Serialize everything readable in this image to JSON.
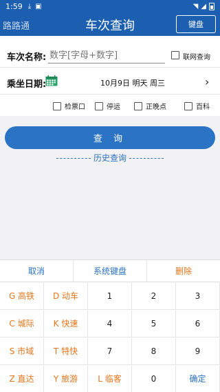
{
  "status": {
    "time": "1:59"
  },
  "appbar": {
    "brand": "路路通",
    "title": "车次查询",
    "keyboard_button": "键盘"
  },
  "form": {
    "train_label": "车次名称:",
    "train_placeholder": "数字[字母+数字]",
    "online_label": "联网查询",
    "date_label": "乘坐日期:",
    "date_value": "10月9日 明天 周三",
    "options": [
      {
        "label": "检票口",
        "checked": false
      },
      {
        "label": "停运",
        "checked": false
      },
      {
        "label": "正晚点",
        "checked": false
      },
      {
        "label": "百科",
        "checked": false
      }
    ]
  },
  "query_button": "查 询",
  "history_link": "历史查询",
  "keyboard": {
    "top": {
      "cancel": "取消",
      "system": "系统键盘",
      "delete": "删除"
    },
    "colors": {
      "letter": "#e8741a",
      "action": "#2b73c4"
    },
    "keys": [
      [
        "G 高铁",
        "D 动车",
        "1",
        "2",
        "3"
      ],
      [
        "C 城际",
        "K 快速",
        "4",
        "5",
        "6"
      ],
      [
        "S 市域",
        "T 特快",
        "7",
        "8",
        "9"
      ],
      [
        "Z 直达",
        "Y 旅游",
        "L 临客",
        "0",
        "确定"
      ]
    ]
  }
}
